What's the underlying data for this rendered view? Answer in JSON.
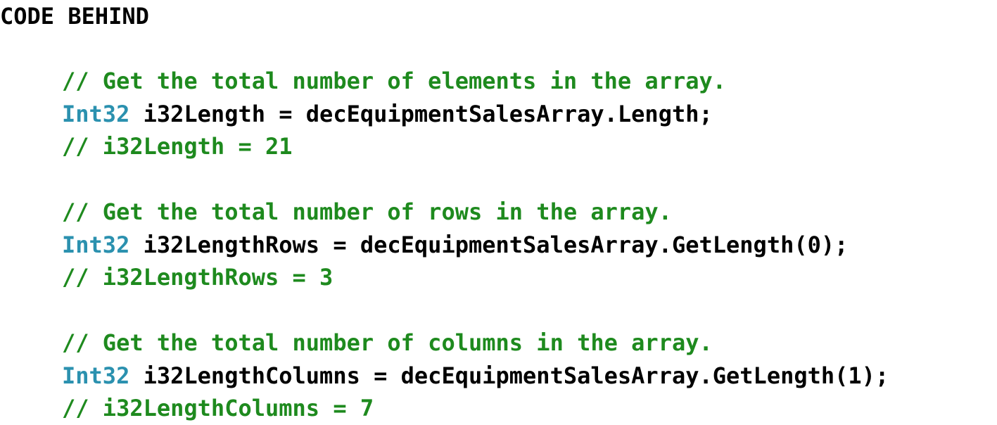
{
  "heading": "CODE BEHIND",
  "colors": {
    "comment": "#1e8a1e",
    "type": "#2b91af",
    "text": "#000000"
  },
  "blocks": [
    {
      "comment": "// Get the total number of elements in the array.",
      "type": "Int32",
      "statement": " i32Length = decEquipmentSalesArray.Length;",
      "result": "// i32Length = 21"
    },
    {
      "comment": "// Get the total number of rows in the array.",
      "type": "Int32",
      "statement": " i32LengthRows = decEquipmentSalesArray.GetLength(0);",
      "result": "// i32LengthRows = 3"
    },
    {
      "comment": "// Get the total number of columns in the array.",
      "type": "Int32",
      "statement": " i32LengthColumns = decEquipmentSalesArray.GetLength(1);",
      "result": "// i32LengthColumns = 7"
    }
  ]
}
